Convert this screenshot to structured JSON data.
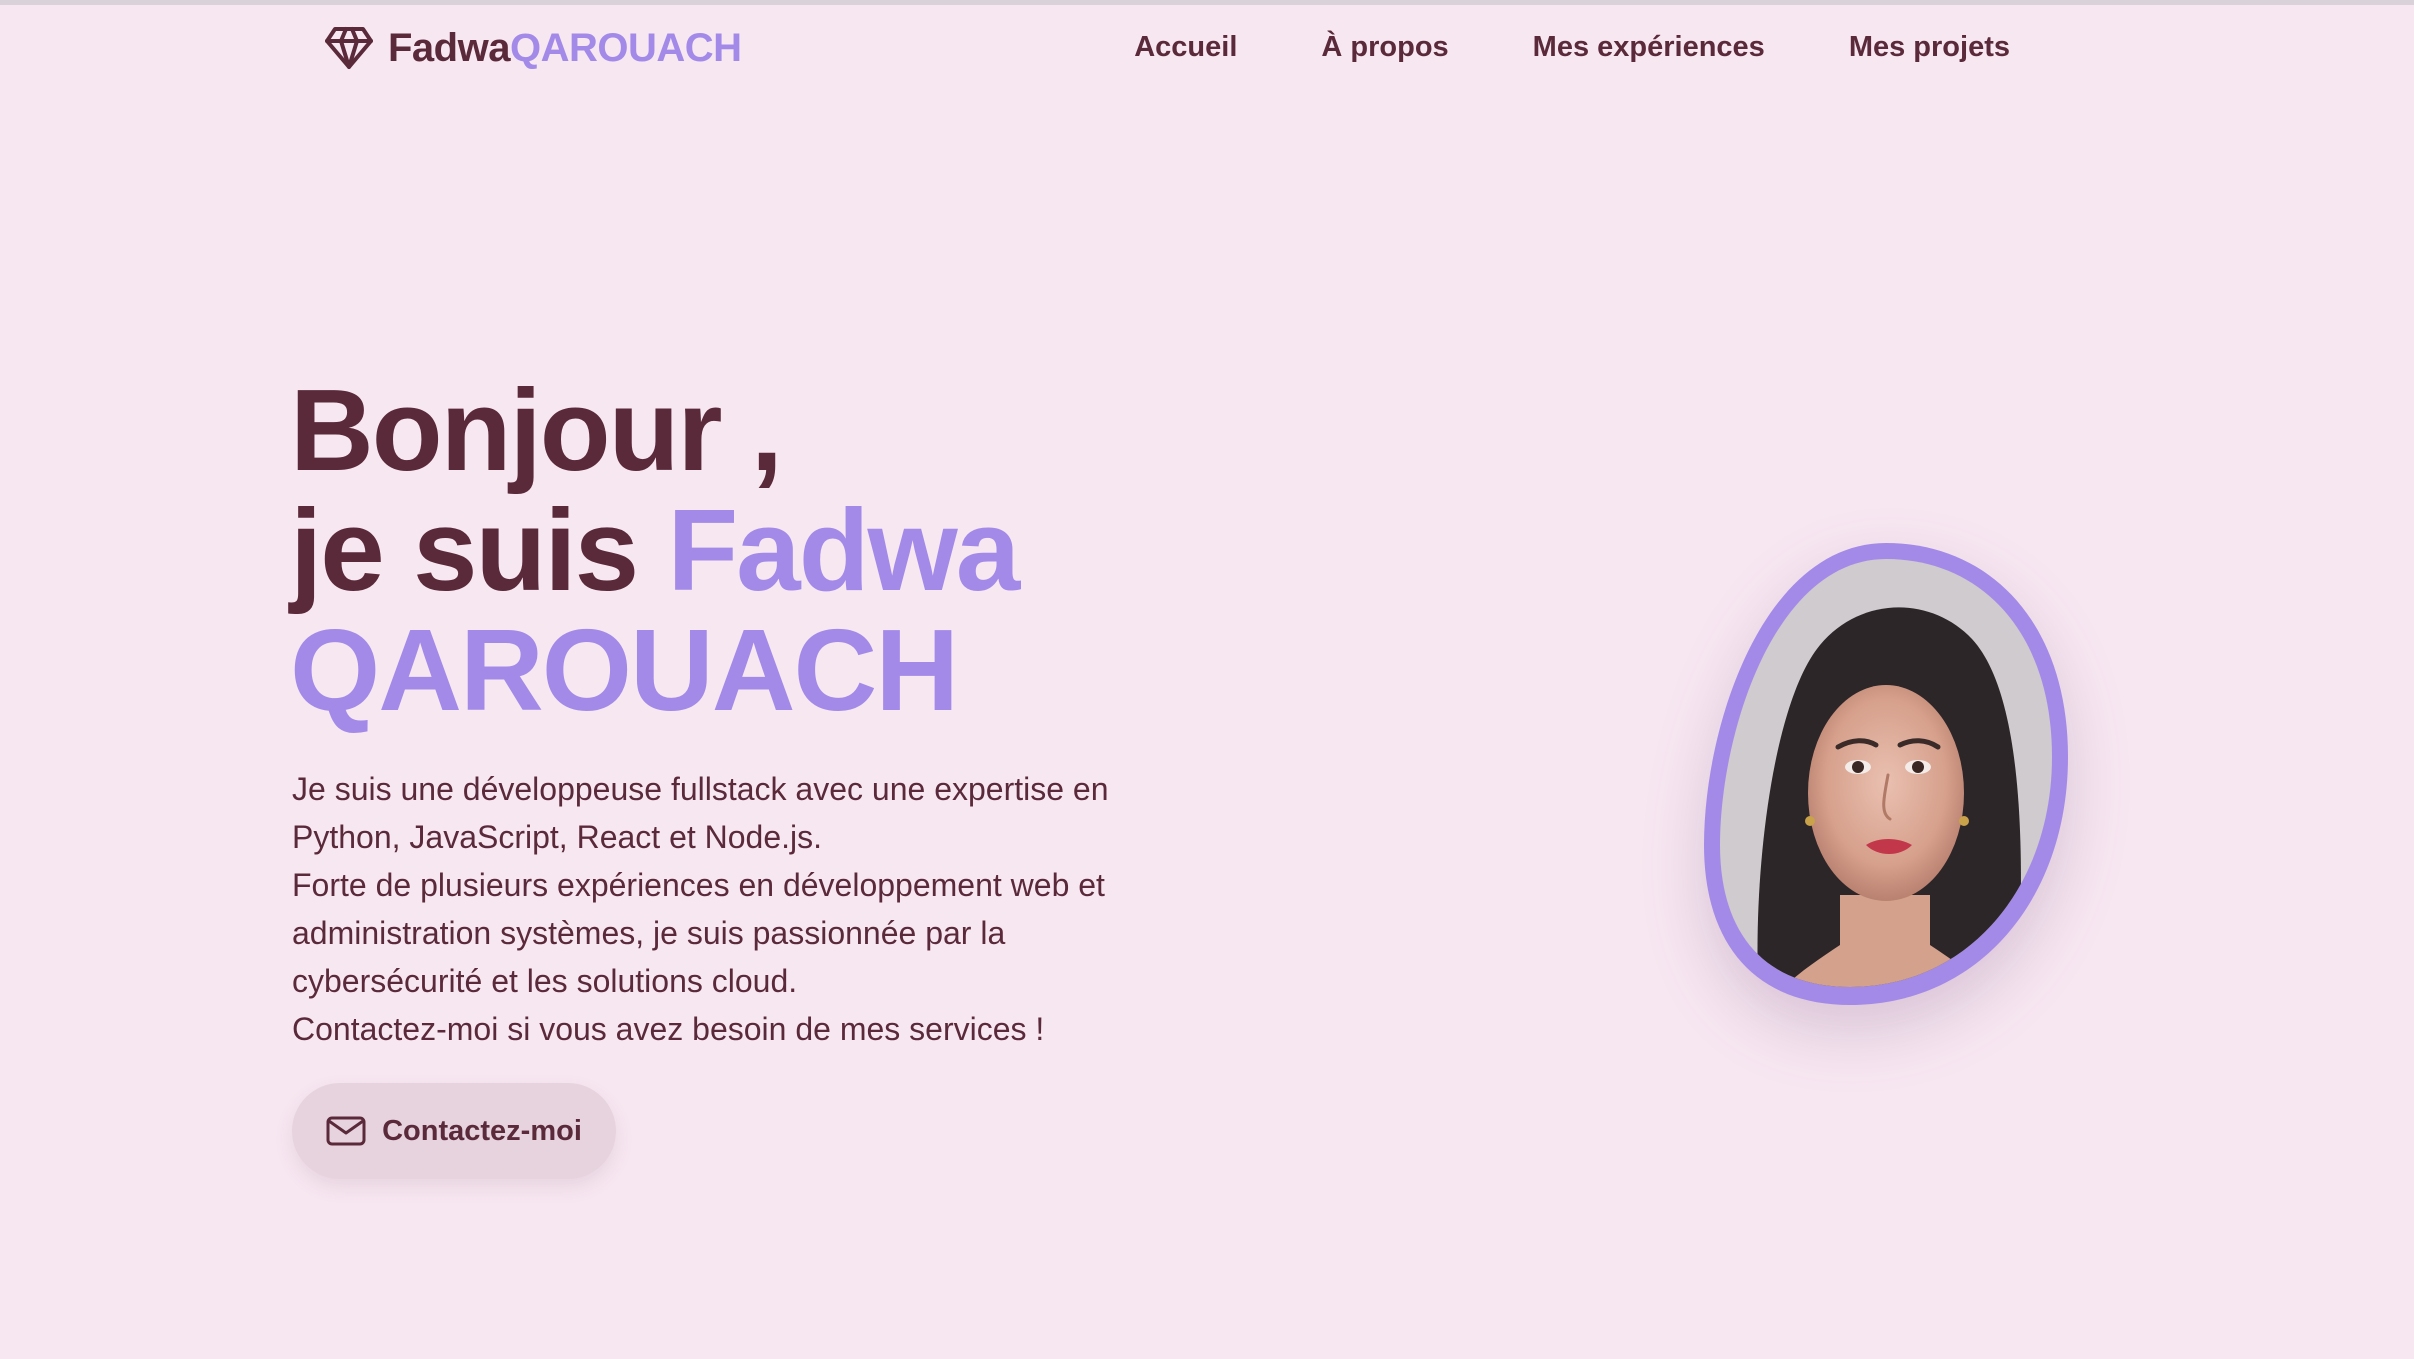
{
  "header": {
    "brand": {
      "first": "Fadwa",
      "last": "QAROUACH",
      "icon": "diamond-icon"
    },
    "nav": [
      {
        "label": "Accueil"
      },
      {
        "label": "À propos"
      },
      {
        "label": "Mes expériences"
      },
      {
        "label": "Mes projets"
      }
    ]
  },
  "hero": {
    "greeting": "Bonjour ,",
    "intro": "je suis",
    "first_name": "Fadwa",
    "last_name": "QAROUACH",
    "bio": [
      "Je suis une développeuse fullstack avec une expertise en Python, JavaScript, React et Node.js.",
      "Forte de plusieurs expériences en développement web et administration systèmes, je suis passionnée par la cybersécurité et les solutions cloud.",
      "Contactez-moi si vous avez besoin de mes services !"
    ],
    "contact_button": {
      "label": "Contactez-moi",
      "icon": "mail-icon"
    },
    "portrait": "portrait-photo"
  },
  "colors": {
    "background": "#f7e7f1",
    "text": "#5b2a3a",
    "accent": "#a48ae8",
    "button_bg": "#e6d3de"
  }
}
